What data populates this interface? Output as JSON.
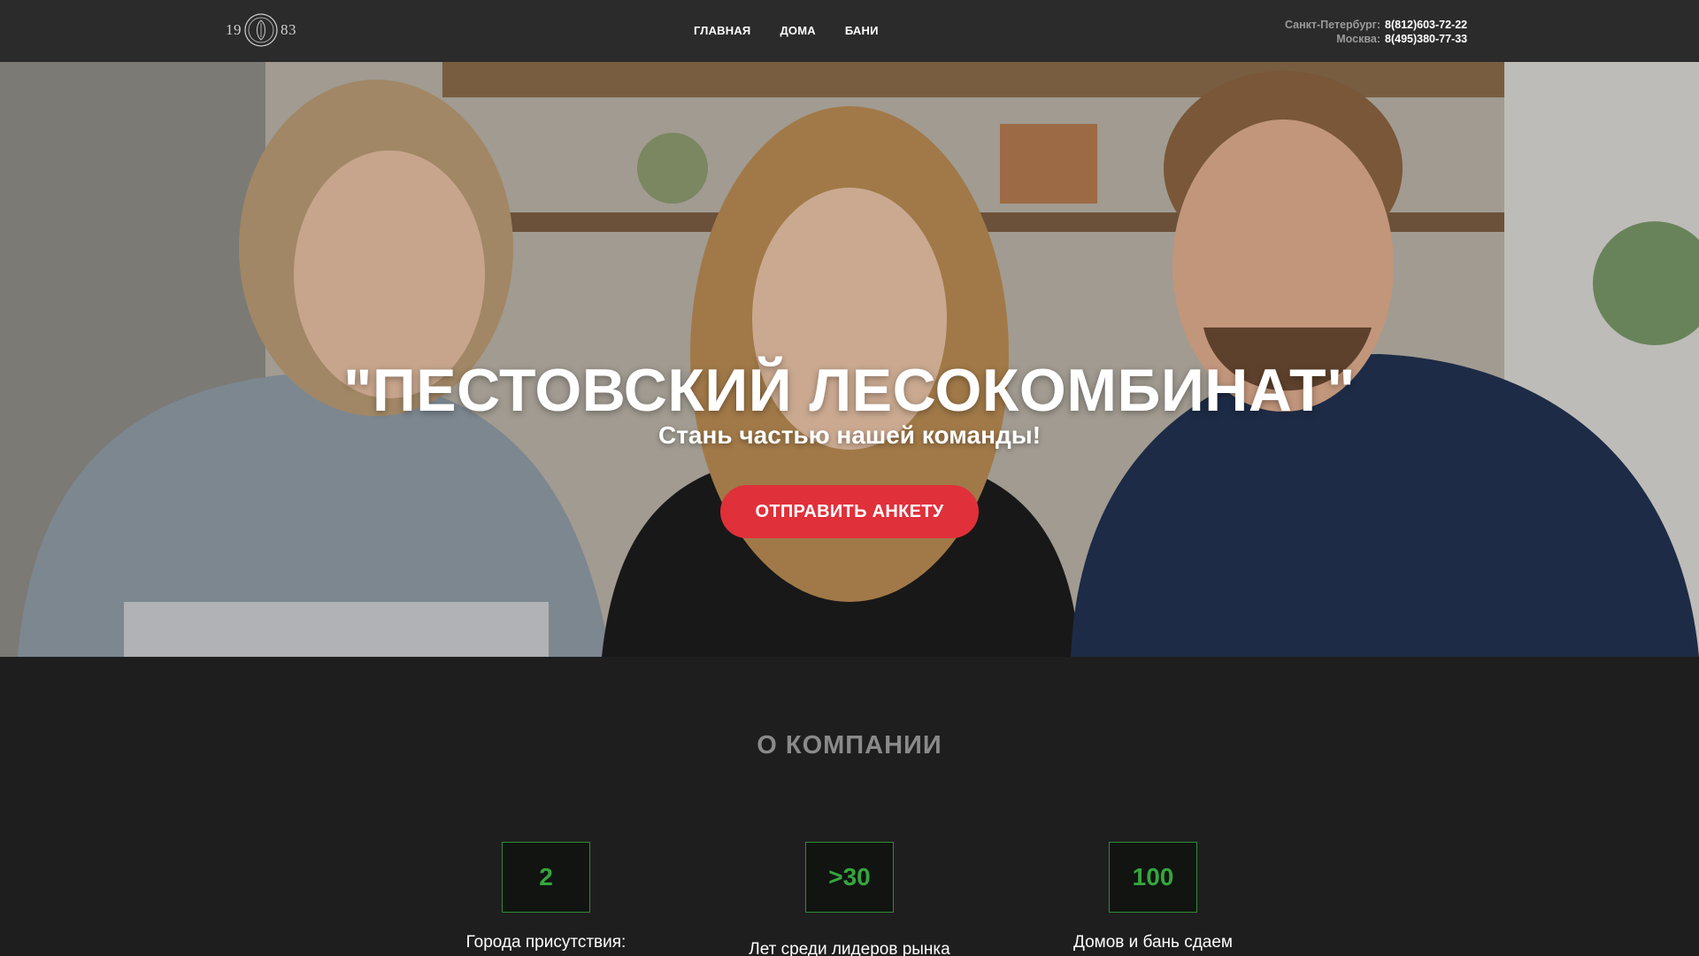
{
  "header": {
    "logo": {
      "left": "19",
      "right": "83",
      "emblem_icon": "crest-icon"
    },
    "nav": [
      {
        "label": "ГЛАВНАЯ"
      },
      {
        "label": "ДОМА"
      },
      {
        "label": "БАНИ"
      }
    ],
    "contacts": [
      {
        "city": "Санкт-Петербург:",
        "phone": "8(812)603-72-22"
      },
      {
        "city": "Москва:",
        "phone": "8(495)380-77-33"
      }
    ]
  },
  "hero": {
    "title": "\"ПЕСТОВСКИЙ ЛЕСОКОМБИНАТ\"",
    "subtitle": "Стань частью нашей команды!",
    "button_label": "ОТПРАВИТЬ АНКЕТУ"
  },
  "about": {
    "title": "О КОМПАНИИ",
    "stats": [
      {
        "value": "2",
        "label": "Города присутствия:"
      },
      {
        "value": ">30",
        "label": "Лет среди лидеров рынка"
      },
      {
        "value": "100",
        "label": "Домов и бань сдаем"
      }
    ]
  },
  "colors": {
    "accent_red": "#e0303a",
    "accent_green": "#35a63d",
    "header_bg": "#2b2b2b",
    "page_bg": "#1e1e1e"
  }
}
